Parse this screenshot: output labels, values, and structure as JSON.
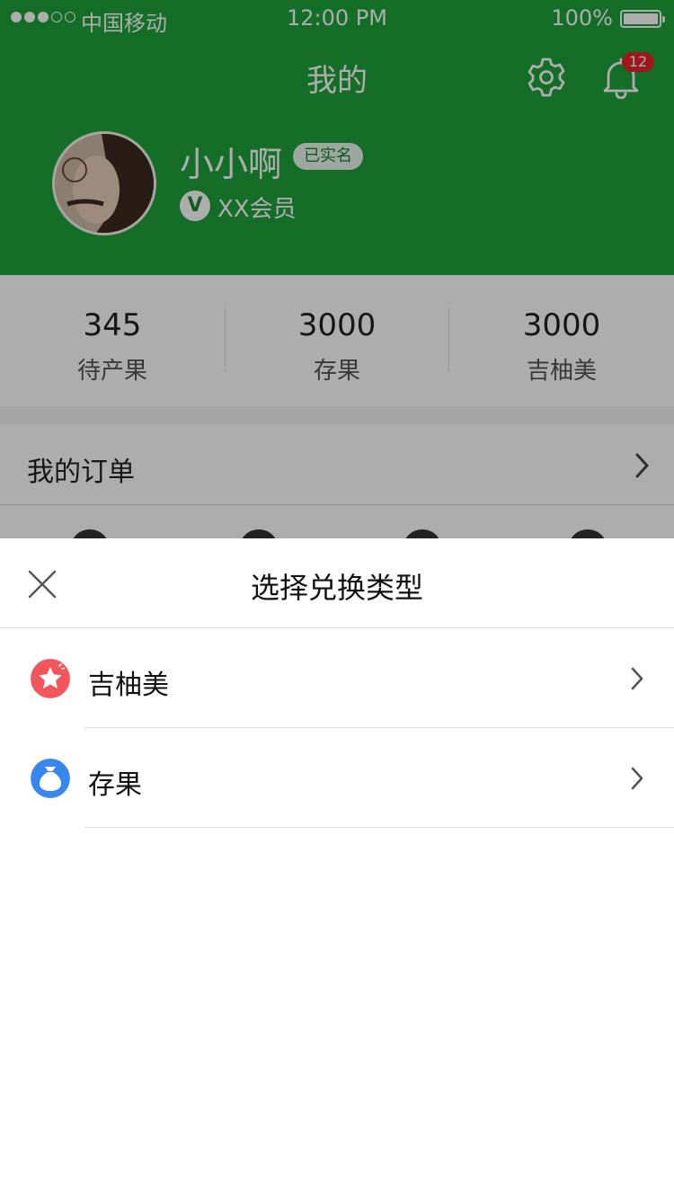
{
  "status_bar": {
    "carrier": "中国移动",
    "time": "12:00 PM",
    "battery": "100%"
  },
  "header": {
    "title": "我的",
    "bell_badge": "12"
  },
  "profile": {
    "username": "小小啊",
    "verified_badge": "已实名",
    "member_icon": "V",
    "member_label": "XX会员"
  },
  "stats": [
    {
      "value": "345",
      "label": "待产果"
    },
    {
      "value": "3000",
      "label": "存果"
    },
    {
      "value": "3000",
      "label": "吉柚美"
    }
  ],
  "orders": {
    "label": "我的订单"
  },
  "sheet": {
    "title": "选择兑换类型",
    "options": [
      {
        "label": "吉柚美",
        "icon": "star-icon",
        "color": "#f2555a"
      },
      {
        "label": "存果",
        "icon": "money-bag-icon",
        "color": "#3a86f0"
      }
    ]
  },
  "colors": {
    "brand_green": "#1fa23a",
    "badge_red": "#e8262a"
  }
}
